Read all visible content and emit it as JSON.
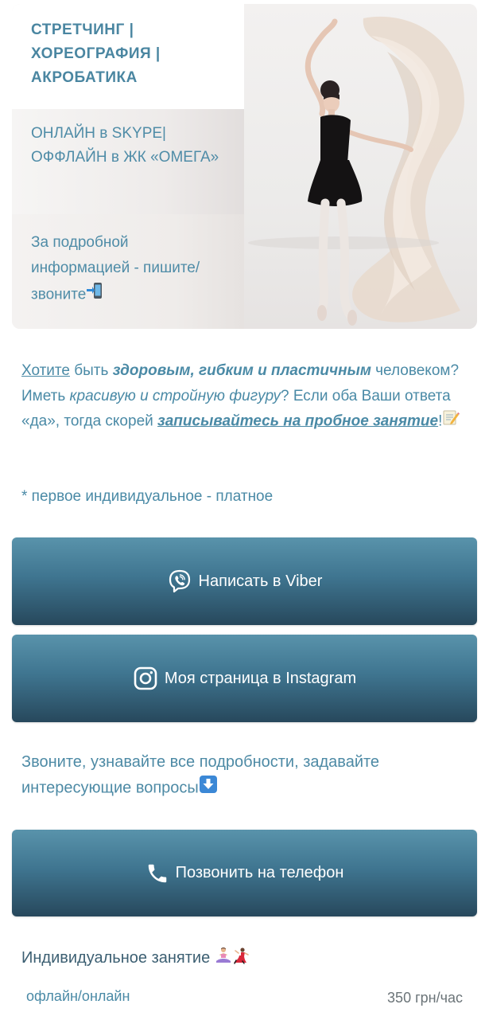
{
  "hero": {
    "title": "СТРЕТЧИНГ | ХОРЕОГРАФИЯ | АКРОБАТИКА",
    "subtitle": "ОНЛАЙН в SKYPE| ОФФЛАЙН в ЖК «ОМЕГА»",
    "info": "За подробной информацией - пишите/ звоните",
    "info_icon": "mobile-phone-arrow-icon",
    "photo": "dancer-with-silk-fabric-photo"
  },
  "description": {
    "part1_underlined": "Хотите",
    "part2": " быть ",
    "part3_bold_italic": "здоровым, гибким и пластичным",
    "part4": " человеком? Иметь ",
    "part5_italic": "красивую и стройную фигуру",
    "part6": "? Если оба Ваши ответа «да», тогда скорей ",
    "part7_bold_italic_underlined": "записывайтесь на пробное занятие",
    "part8": "!",
    "end_icon": "memo-pencil-icon"
  },
  "note": "* первое индивидуальное - платное",
  "buttons": {
    "viber": "Написать в Viber",
    "instagram": "Моя страница в Instagram",
    "phone": "Позвонить на телефон"
  },
  "call_text": "Звоните, узнавайте все подробности, задавайте интересующие вопросы",
  "call_icon": "down-arrow-icon",
  "price": {
    "title": "Индивидуальное занятие",
    "format": "офлайн/онлайн",
    "value": "350 грн/час"
  },
  "colors": {
    "accent": "#4a8aa6",
    "button_top": "#5993ab",
    "button_bottom": "#27485c"
  }
}
